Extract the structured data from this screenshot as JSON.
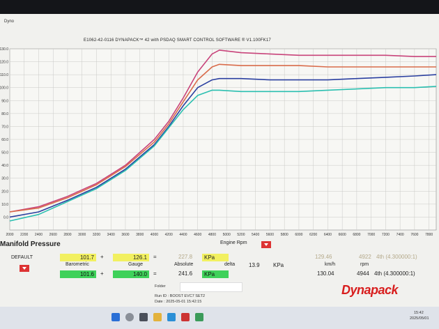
{
  "window": {
    "app_name": "Dyno",
    "title": "E1062-42-0116 DYNAPACK™ 42 with PSDAQ SMART CONTROL SOFTWARE ® V1.100FK17"
  },
  "chart_data": {
    "type": "line",
    "title": "E1062-42-0116 DYNAPACK™ 42 with PSDAQ SMART CONTROL SOFTWARE ® V1.100FK17",
    "xlabel": "Engine Rpm",
    "ylabel": "",
    "xlim": [
      2000,
      7900
    ],
    "ylim": [
      -10,
      130
    ],
    "x_ticks": [
      2000,
      2200,
      2400,
      2600,
      2800,
      3000,
      3200,
      3400,
      3600,
      3800,
      4000,
      4200,
      4400,
      4600,
      4800,
      5000,
      5200,
      5400,
      5600,
      5800,
      6000,
      6200,
      6400,
      6600,
      6800,
      7000,
      7200,
      7400,
      7600,
      7800
    ],
    "y_ticks": [
      0,
      10,
      20,
      30,
      40,
      50,
      60,
      70,
      80,
      90,
      100,
      110,
      120,
      130
    ],
    "y_tick_labels": [
      "0.0",
      "10.0",
      "20.0",
      "30.0",
      "40.0",
      "50.0",
      "60.0",
      "70.0",
      "80.0",
      "90.0",
      "100.0",
      "110.0",
      "120.0",
      "130.0"
    ],
    "grid": true,
    "series": [
      {
        "color": "#c8437a",
        "x": [
          2000,
          2400,
          2800,
          3200,
          3600,
          4000,
          4200,
          4400,
          4600,
          4800,
          4900,
          5200,
          5600,
          6000,
          6400,
          6800,
          7200,
          7600,
          7900
        ],
        "y": [
          4,
          8,
          16,
          26,
          40,
          60,
          74,
          92,
          112,
          126,
          129,
          127,
          126,
          125,
          125,
          125,
          125,
          124,
          124
        ]
      },
      {
        "color": "#d96b4a",
        "x": [
          2000,
          2400,
          2800,
          3200,
          3600,
          4000,
          4200,
          4400,
          4600,
          4800,
          4900,
          5200,
          5600,
          6000,
          6400,
          6800,
          7200,
          7600,
          7900
        ],
        "y": [
          4,
          7,
          15,
          25,
          39,
          58,
          72,
          89,
          106,
          116,
          118,
          117,
          117,
          117,
          116,
          116,
          116,
          116,
          116
        ]
      },
      {
        "color": "#2a3fa0",
        "x": [
          2000,
          2400,
          2800,
          3200,
          3600,
          4000,
          4200,
          4400,
          4600,
          4800,
          4900,
          5200,
          5600,
          6000,
          6400,
          6800,
          7200,
          7600,
          7900
        ],
        "y": [
          0,
          4,
          13,
          23,
          37,
          56,
          70,
          86,
          100,
          106,
          107,
          107,
          106,
          106,
          106,
          107,
          108,
          109,
          110
        ]
      },
      {
        "color": "#2bbfb0",
        "x": [
          2000,
          2400,
          2800,
          3200,
          3600,
          4000,
          4200,
          4400,
          4600,
          4800,
          4900,
          5200,
          5600,
          6000,
          6400,
          6800,
          7200,
          7600,
          7900
        ],
        "y": [
          -3,
          2,
          12,
          22,
          36,
          55,
          69,
          83,
          94,
          98,
          98,
          97,
          97,
          97,
          98,
          99,
          100,
          100,
          101
        ]
      }
    ]
  },
  "panel": {
    "section_title": "Manifold Pressure",
    "engine_rpm_label": "Engine Rpm",
    "mode": "DEFAULT",
    "row1": {
      "barometric": "101.7",
      "plus": "+",
      "gauge": "126.1",
      "eq": "=",
      "absolute": "227.8",
      "unit": "KPa",
      "speed": "129.46",
      "rpm": "4922",
      "gear": "4th (4.300000:1)"
    },
    "labels": {
      "barometric": "Barometric",
      "gauge": "Gauge",
      "absolute": "Absolute",
      "delta": "delta",
      "delta_value": "13.9",
      "delta_unit": "KPa",
      "kmh": "km/h",
      "rpm": "rpm"
    },
    "row2": {
      "barometric": "101.6",
      "plus": "+",
      "gauge": "140.0",
      "eq": "=",
      "absolute": "241.6",
      "unit": "KPa",
      "speed": "130.04",
      "rpm": "4944",
      "gear": "4th (4.300000:1)"
    },
    "folder_label": "Folder",
    "run_id": "Run ID : BOOST EVC7 SET2",
    "date": "Date : 2025-05-01 15:42:15",
    "logo": "Dynapack"
  },
  "taskbar": {
    "time": "15:42",
    "date": "2025/05/01"
  }
}
